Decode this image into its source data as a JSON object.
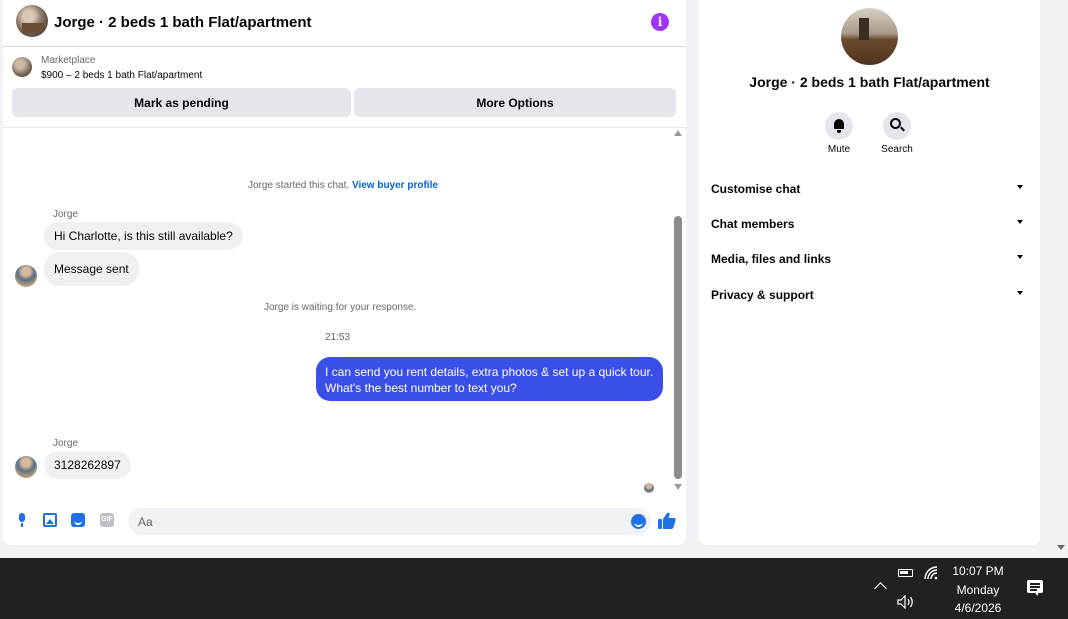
{
  "chat": {
    "header_title": "Jorge · 2 beds 1 bath Flat/apartment",
    "info_glyph": "i",
    "marketplace_label": "Marketplace",
    "listing_summary": "$900 – 2 beds 1 bath Flat/apartment",
    "mark_pending_label": "Mark as pending",
    "more_options_label": "More Options",
    "started_text": "Jorge started this chat.",
    "view_profile_link": "View buyer profile",
    "sender_name": "Jorge",
    "msg1": "Hi Charlotte, is this still available?",
    "msg2": "Message sent",
    "waiting_text": "Jorge is waiting for your response.",
    "timestamp": "21:53",
    "outgoing_line1": "I can send you rent details, extra photos & set up a quick tour.",
    "outgoing_line2": "What's the best number to text you?",
    "sender_name_2": "Jorge",
    "msg3": "3128262897",
    "composer_placeholder": "Aa",
    "gif_label": "GIF"
  },
  "details": {
    "profile_name": "Jorge · 2 beds 1 bath Flat/apartment",
    "mute_label": "Mute",
    "search_label": "Search",
    "sections": [
      "Customise chat",
      "Chat members",
      "Media, files and links",
      "Privacy & support"
    ]
  },
  "taskbar": {
    "time": "10:07 PM",
    "day": "Monday",
    "date": "4/6/2026"
  },
  "colors": {
    "accent_blue": "#3a4fe8",
    "messenger_blue": "#1f6fe5",
    "info_purple": "#a033ff",
    "link_blue": "#0064d1"
  },
  "icons": [
    "info-icon",
    "mic-icon",
    "image-icon",
    "sticker-icon",
    "gif-icon",
    "emoji-icon",
    "like-icon",
    "bell-icon",
    "search-icon",
    "chevron-down-icon",
    "battery-icon",
    "wifi-icon",
    "volume-icon",
    "notification-icon"
  ]
}
